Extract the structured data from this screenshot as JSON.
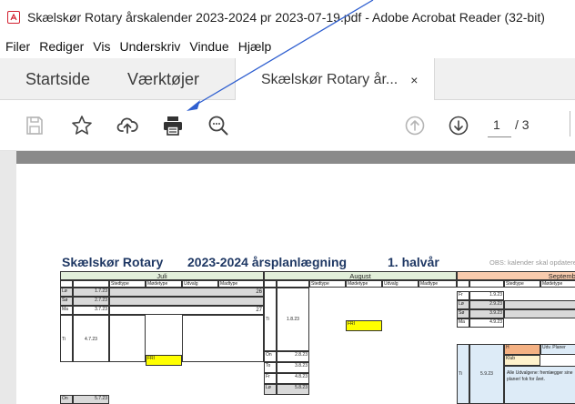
{
  "window": {
    "title": "Skælskør Rotary årskalender 2023-2024 pr 2023-07-19.pdf - Adobe Acrobat Reader (32-bit)",
    "app_icon": "acrobat-icon"
  },
  "menu": [
    "Filer",
    "Rediger",
    "Vis",
    "Underskriv",
    "Vindue",
    "Hjælp"
  ],
  "tabs": {
    "home": "Startside",
    "tools": "Værktøjer",
    "document": "Skælskør Rotary år...",
    "close_glyph": "×"
  },
  "toolbar": {
    "icons": [
      "save-icon",
      "bookmark-star-icon",
      "upload-cloud-icon",
      "print-icon",
      "search-zoom-icon",
      "page-up-icon",
      "page-down-icon"
    ],
    "page_current": "1",
    "page_total": "/ 3"
  },
  "document": {
    "org": "Skælskør Rotary",
    "period": "2023-2024 årsplanlægning",
    "half": "1. halvår",
    "note": "OBS: kalender skal opdateres r",
    "months": [
      "Juli",
      "August",
      "Septembe"
    ],
    "columns": [
      "Stedtype",
      "Mødetype",
      "Udvalg",
      "Madtype"
    ],
    "week_numbers": [
      "26",
      "27"
    ],
    "july_rows": [
      {
        "day": "Lø",
        "date": "1.7.23"
      },
      {
        "day": "Sø",
        "date": "2.7.23"
      },
      {
        "day": "Ma",
        "date": "3.7.23"
      },
      {
        "day": "Ti",
        "date": "4.7.23"
      },
      {
        "day": "On",
        "date": "5.7.23"
      }
    ],
    "aug_rows": [
      {
        "day": "Ti",
        "date": "1.8.23"
      },
      {
        "day": "On",
        "date": "2.8.23"
      },
      {
        "day": "To",
        "date": "3.8.23"
      },
      {
        "day": "Fr",
        "date": "4.8.23"
      },
      {
        "day": "Lø",
        "date": "5.8.23"
      }
    ],
    "sep_rows": [
      {
        "day": "Fr",
        "date": "1.9.23"
      },
      {
        "day": "Lø",
        "date": "2.9.23"
      },
      {
        "day": "Sø",
        "date": "3.9.23"
      },
      {
        "day": "Ma",
        "date": "4.9.23"
      },
      {
        "day": "Ti",
        "date": "5.9.23"
      }
    ],
    "fri_label": "FRI",
    "sep_h": "H",
    "sep_udv": "Udv. Planer",
    "sep_klub": "Klub",
    "sep_note": "Alle Udvalgene: fremlægger sine planer/ fok for året."
  },
  "colors": {
    "accent_red": "#d2202f",
    "arrow_blue": "#2f5fd0",
    "header_navy": "#1f3864",
    "highlight_yellow": "#ffff00"
  }
}
